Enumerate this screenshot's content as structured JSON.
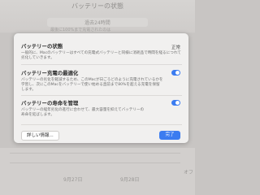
{
  "background": {
    "title": "バッテリーの状態",
    "segment_label": "過去24時間",
    "subtext": "最後に100%まで充電されたのは",
    "axis_labels": [
      "9月27日",
      "9月28日"
    ],
    "right_label": "オフ"
  },
  "dialog": {
    "status": {
      "title": "バッテリーの状態",
      "value": "正常",
      "desc_line1": "一般的に、Macのバッテリーはすべての充電式バッテリーと同様に消耗品で時間を経るにつれて",
      "desc_line2": "劣化していきます。"
    },
    "optimized_charging": {
      "title": "バッテリー充電の最適化",
      "desc_line1": "バッテリーの劣化を軽減するため、このMacが日ごろどのように充電されているかを",
      "desc_line2": "学習し、次にこのMacをバッテリーで使い始める直前まで80%を超える充電を保留",
      "desc_line3": "します。",
      "enabled": true
    },
    "health_management": {
      "title": "バッテリーの寿命を管理",
      "desc_line1": "バッテリーの経年劣化の進行に合わせて、最大容量を抑えてバッテリーの",
      "desc_line2": "寿命を延ばします。",
      "enabled": true
    },
    "details_button": "詳しい情報...",
    "done_button": "完了"
  },
  "colors": {
    "accent": "#3b7cf0",
    "dialog_bg": "#f1f0ef"
  }
}
